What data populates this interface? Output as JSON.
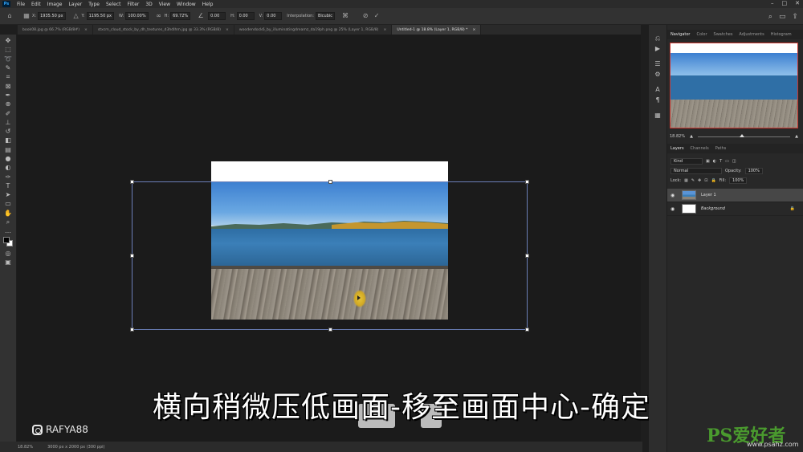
{
  "menubar": {
    "logo": "Ps",
    "items": [
      "File",
      "Edit",
      "Image",
      "Layer",
      "Type",
      "Select",
      "Filter",
      "3D",
      "View",
      "Window",
      "Help"
    ],
    "controls": [
      "–",
      "□",
      "✕"
    ]
  },
  "options": {
    "x_label": "X:",
    "x_value": "1935.50 px",
    "y_label": "Y:",
    "y_value": "1195.50 px",
    "w_label": "W:",
    "w_value": "100.00%",
    "h_label": "H:",
    "h_value": "69.72%",
    "angle_value": "0.00",
    "hskew_label": "H:",
    "hskew_value": "0.00",
    "vskew_label": "V:",
    "vskew_value": "0.00",
    "interp_label": "Interpolation:",
    "interp_value": "Bicubic"
  },
  "tabs": [
    {
      "label": "book08.jpg @ 66.7% (RGB/8#)",
      "active": false
    },
    {
      "label": "stxcm_cloud_stock_by_dh_textures_d3hdlhm.jpg @ 33.3% (RGB/8)",
      "active": false
    },
    {
      "label": "woodendock6_by_illuminatingdreamz_da19ph.png @ 25% (Layer 1, RGB/8)",
      "active": false
    },
    {
      "label": "Untitled-1 @ 18.8% (Layer 1, RGB/8) *",
      "active": true
    }
  ],
  "tools": [
    "move-icon",
    "marquee-icon",
    "lasso-icon",
    "quick-select-icon",
    "crop-icon",
    "frame-icon",
    "eyedropper-icon",
    "healing-icon",
    "brush-icon",
    "stamp-icon",
    "history-brush-icon",
    "eraser-icon",
    "gradient-icon",
    "blur-icon",
    "dodge-icon",
    "pen-icon",
    "type-icon",
    "path-select-icon",
    "shape-icon",
    "hand-icon",
    "zoom-icon",
    "more-icon"
  ],
  "caption": "横向稍微压低画面-移至画面中心-确定",
  "instagram": "RAFYA88",
  "status": {
    "zoom": "18.82%",
    "doc": "3000 px x 2000 px (300 ppi)"
  },
  "panels": {
    "nav_tabs": [
      "Navigator",
      "Color",
      "Swatches",
      "Adjustments",
      "Histogram"
    ],
    "nav_zoom": "18.82%",
    "layer_tabs": [
      "Layers",
      "Channels",
      "Paths"
    ],
    "kind_label": "Kind",
    "blend_mode": "Normal",
    "opacity_label": "Opacity:",
    "opacity_value": "100%",
    "lock_label": "Lock:",
    "fill_label": "Fill:",
    "fill_value": "100%",
    "layers": [
      {
        "name": "Layer 1",
        "active": true
      },
      {
        "name": "Background",
        "active": false
      }
    ]
  },
  "watermark": {
    "main": "PS爱好者",
    "url": "www.psahz.com"
  }
}
